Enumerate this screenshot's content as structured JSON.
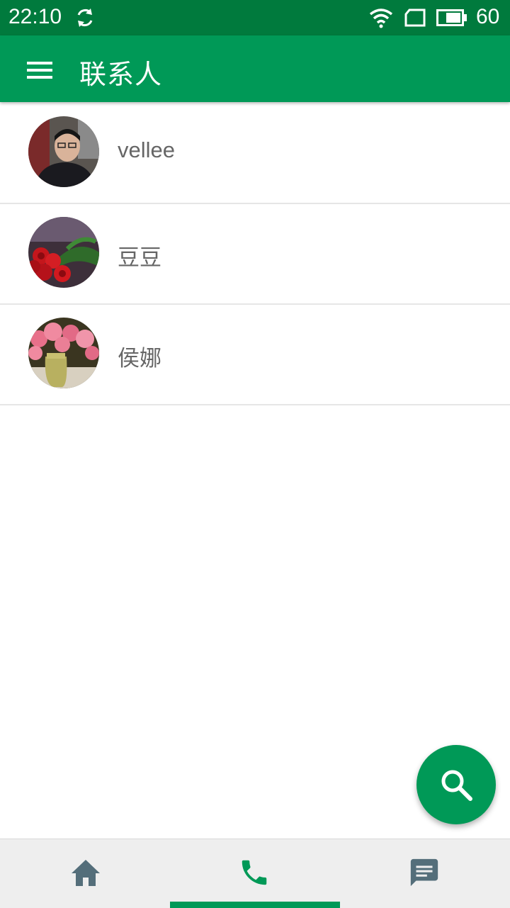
{
  "status_bar": {
    "time": "22:10",
    "battery": "60"
  },
  "app_bar": {
    "title": "联系人",
    "menu_icon": "menu-icon"
  },
  "contacts": [
    {
      "name": "vellee",
      "avatar": "person-photo"
    },
    {
      "name": "豆豆",
      "avatar": "roses-photo"
    },
    {
      "name": "侯娜",
      "avatar": "flower-vase-photo"
    }
  ],
  "fab": {
    "icon": "search-icon"
  },
  "bottom_nav": {
    "items": [
      {
        "icon": "home-icon",
        "active": false
      },
      {
        "icon": "phone-icon",
        "active": true
      },
      {
        "icon": "message-icon",
        "active": false
      }
    ]
  },
  "colors": {
    "primary": "#009957",
    "status_bar": "#007a3d",
    "inactive_icon": "#546e7a"
  }
}
